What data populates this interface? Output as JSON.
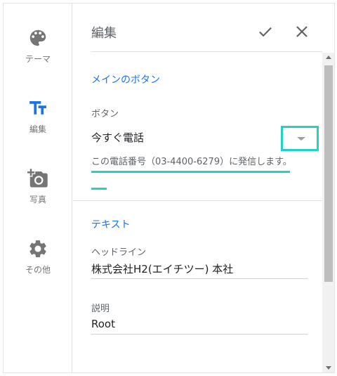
{
  "rail": {
    "items": [
      {
        "label": "テーマ",
        "icon": "palette-icon"
      },
      {
        "label": "編集",
        "icon": "text-fields-icon"
      },
      {
        "label": "写真",
        "icon": "add-photo-icon"
      },
      {
        "label": "その他",
        "icon": "gear-icon"
      }
    ],
    "active": "編集"
  },
  "header": {
    "title": "編集",
    "confirm_icon": "check-icon",
    "close_icon": "close-icon"
  },
  "sections": {
    "main_button": {
      "heading": "メインのボタン",
      "button_label": "ボタン",
      "button_value": "今すぐ電話",
      "description": "この電話番号（03-4400-6279）に発信します。"
    },
    "text": {
      "heading": "テキスト",
      "headline_label": "ヘッドライン",
      "headline_value": "株式会社H2(エイチツー) 本社",
      "description_label": "説明",
      "description_value": "Root"
    }
  },
  "colors": {
    "accent": "#1a73e8",
    "highlight": "#22d3c1",
    "icon_gray": "#757575",
    "icon_active": "#1a73e8"
  }
}
